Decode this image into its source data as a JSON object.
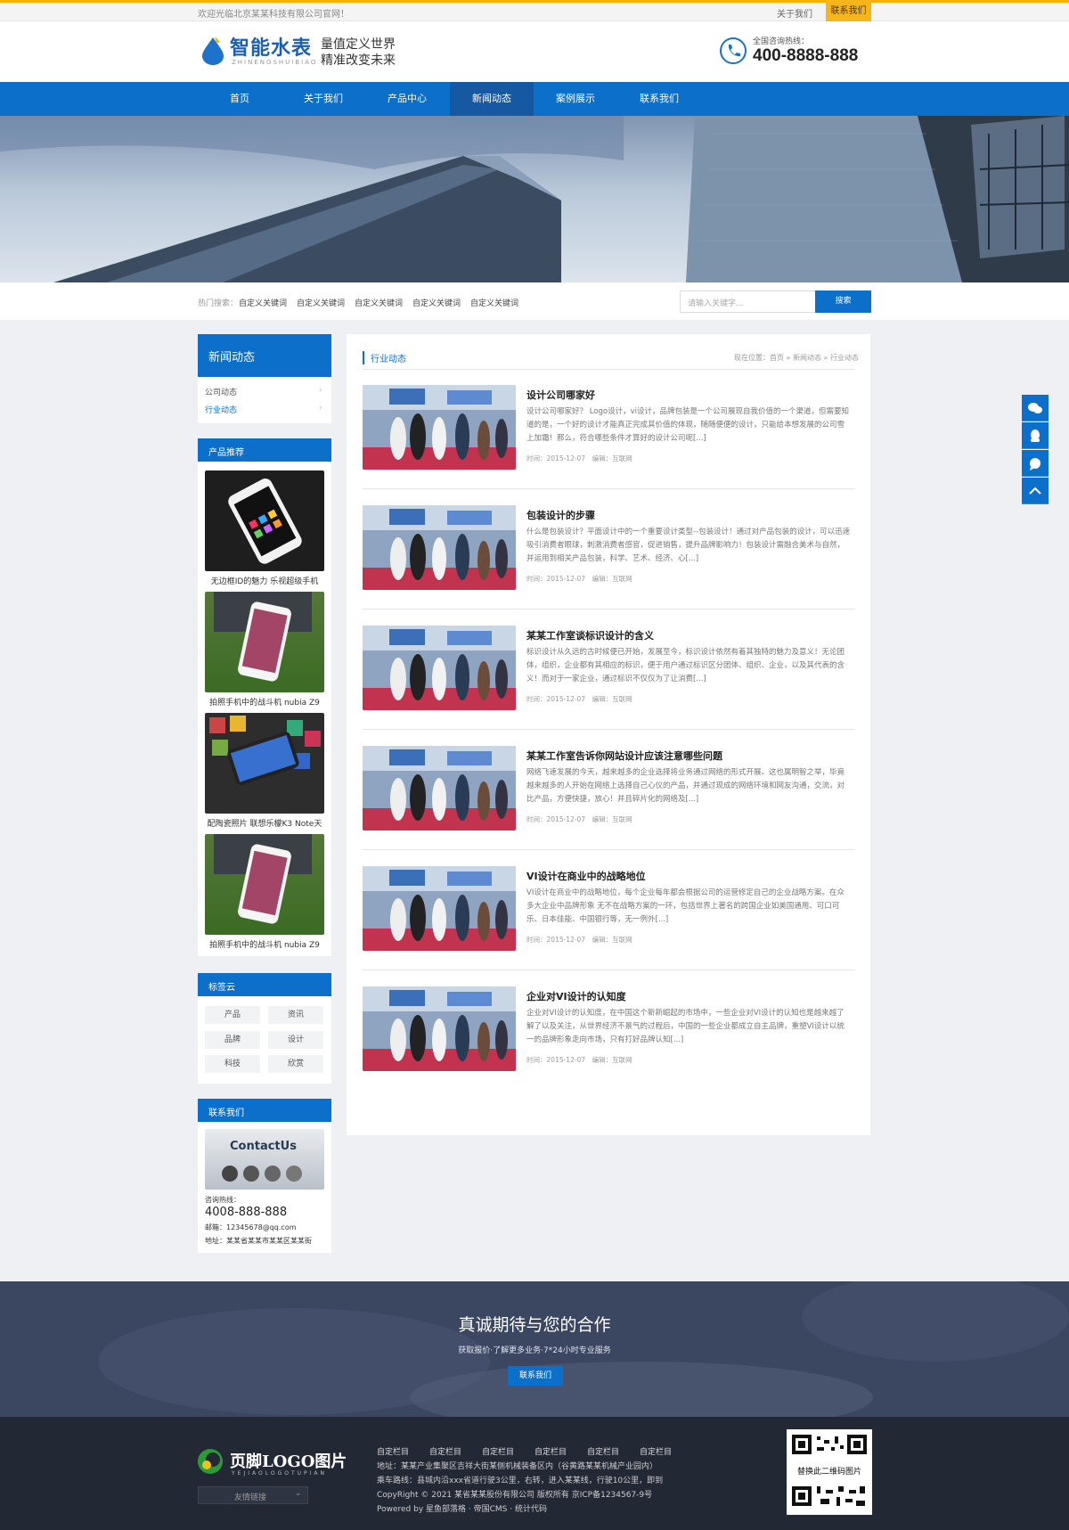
{
  "topbar": {
    "welcome": "欢迎光临北京某某科技有限公司官网！",
    "about": "关于我们",
    "contact": "联系我们"
  },
  "header": {
    "logo_title": "智能水表",
    "logo_sub": "ZHINENGSHUIBIAO",
    "slogan1": "量值定义世界",
    "slogan2": "精准改变未来",
    "hotline_label": "全国咨询热线：",
    "hotline": "400-8888-888"
  },
  "nav": {
    "items": [
      "首页",
      "关于我们",
      "产品中心",
      "新闻动态",
      "案例展示",
      "联系我们"
    ],
    "active": "新闻动态"
  },
  "search": {
    "hot_label": "热门搜索：",
    "keywords": [
      "自定义关键词",
      "自定义关键词",
      "自定义关键词",
      "自定义关键词",
      "自定义关键词"
    ],
    "placeholder": "请输入关键字...",
    "button": "搜索"
  },
  "sidebar": {
    "title": "新闻动态",
    "links": [
      "公司动态",
      "行业动态"
    ],
    "products_title": "产品推荐",
    "products": [
      "无边框ID的魅力 乐视超级手机",
      "拍照手机中的战斗机 nubia Z9",
      "配陶瓷照片 联想乐檬K3 Note天",
      "拍照手机中的战斗机 nubia Z9"
    ],
    "tags_title": "标签云",
    "tags": [
      "产品",
      "资讯",
      "品牌",
      "设计",
      "科技",
      "欣赏"
    ],
    "contact_title": "联系我们",
    "contact_img_text": "ContactUs",
    "consult_label": "咨询热线：",
    "consult_phone": "4008-888-888",
    "email": "邮箱：12345678@qq.com",
    "address": "地址：某某省某某市某某区某某街"
  },
  "content": {
    "section": "行业动态",
    "crumb": "现在位置：首页 » 新闻动态 » 行业动态",
    "articles": [
      {
        "title": "设计公司哪家好",
        "body": "设计公司哪家好？ Logo设计，vi设计，品牌包装是一个公司展现自我价值的一个渠道，但需要知道的是，一个好的设计才能真正完成其价值的体现，随随便便的设计，只能给本想发展的公司雪上加霜！那么，符合哪些条件才算好的设计公司呢[...]",
        "meta": "时间：2015-12-07　编辑：互联网"
      },
      {
        "title": "包装设计的步骤",
        "body": "什么是包装设计？平面设计中的一个重要设计类型--包装设计！通过对产品包装的设计，可以迅速吸引消费者眼球，刺激消费者感官，促进销售，提升品牌影响力！包装设计需融合美术与自然，并运用到相关产品包装，科学、艺术、经济、心[...]",
        "meta": "时间：2015-12-07　编辑：互联网"
      },
      {
        "title": "某某工作室谈标识设计的含义",
        "body": "标识设计从久远的古时候便已开始，发展至今，标识设计依然有着其独特的魅力及意义！无论团体，组织，企业都有其相应的标识，便于用户通过标识区分团体、组织、企业，以及其代表的含义！而对于一家企业，通过标识不仅仅为了让消费[...]",
        "meta": "时间：2015-12-07　编辑：互联网"
      },
      {
        "title": "某某工作室告诉你网站设计应该注意哪些问题",
        "body": "网络飞速发展的今天，越来越多的企业选择将业务通过网络的形式开展。这也属明智之举，毕竟越来越多的人开始在网络上选择自己心仪的产品，并通过现成的网络环境和网友沟通，交流，对比产品，方便快捷，放心！并且碎片化的网络及[...]",
        "meta": "时间：2015-12-07　编辑：互联网"
      },
      {
        "title": "VI设计在商业中的战略地位",
        "body": "VI设计在商业中的战略地位，每个企业每年都会根据公司的运营修定自己的企业战略方案。在众多大企业中品牌形象 无不在战略方案的一环，包括世界上著名的跨国企业如美国通用、可口可乐、日本佳能、中国银行等，无一例外[...]",
        "meta": "时间：2015-12-07　编辑：互联网"
      },
      {
        "title": "企业对VI设计的认知度",
        "body": "企业对VI设计的认知度，在中国这个新新崛起的市场中，一些企业对VI设计的认知也是越来越了解了以及关注，从世界经济不景气的过程后，中国的一些企业都成立自主品牌，重塑VI设计以统一的品牌形象走向市场，只有打好品牌认知[...]",
        "meta": "时间：2015-12-07　编辑：互联网"
      }
    ]
  },
  "cta": {
    "title": "真诚期待与您的合作",
    "sub": "获取报价·了解更多业务·7*24小时专业服务",
    "button": "联系我们"
  },
  "footer": {
    "logo_title": "页脚LOGO图片",
    "logo_sub": "YEJIAOLOGOTUPIAN",
    "links_select": "友情链接",
    "columns": [
      "自定栏目",
      "自定栏目",
      "自定栏目",
      "自定栏目",
      "自定栏目",
      "自定栏目"
    ],
    "address": "地址：某某产业集聚区吉祥大街某侧机械装备区内（谷黄路某某机械产业园内）",
    "route": "乘车路线：县城内沿xxx省道行驶3公里，右转，进入某某线，行驶10公里，即到",
    "copyright": "CopyRight © 2021 某省某某股份有限公司 版权所有 京ICP备1234567-9号",
    "powered": "Powered by 星鱼部落格 · 帝国CMS · 统计代码",
    "qr_caption": "替换此二维码图片"
  },
  "colors": {
    "primary": "#0c6fc9",
    "accent": "#f7b51c",
    "dark_footer": "#222834"
  }
}
